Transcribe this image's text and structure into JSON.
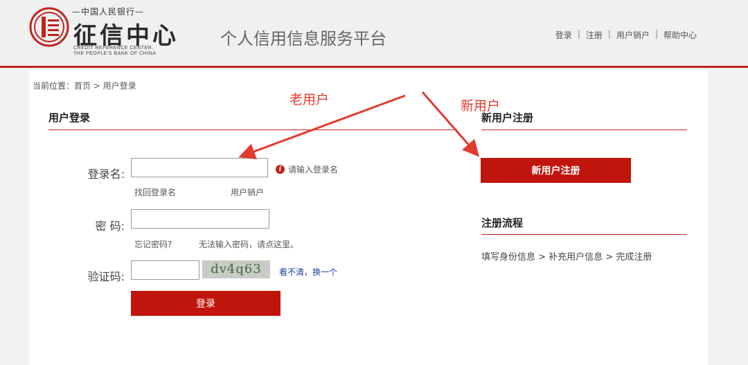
{
  "header": {
    "logo_small": "—中国人民银行—",
    "logo_main": "征信中心",
    "logo_en_line1": "CREDIT REFERENCE CENTER,",
    "logo_en_line2": "THE PEOPLE'S BANK OF CHINA",
    "platform_title": "个人信用信息服务平台",
    "nav": [
      {
        "label": "登录"
      },
      {
        "label": "注册"
      },
      {
        "label": "用户销户"
      },
      {
        "label": "帮助中心"
      }
    ],
    "nav_separator": "|"
  },
  "breadcrumb": "当前位置：首页 > 用户登录",
  "login": {
    "section_title": "用户登录",
    "username_label": "登录名:",
    "username_value": "",
    "username_hint": "请输入登录名",
    "forgot_username": "找回登录名",
    "cancel_account": "用户销户",
    "password_label": "密  码:",
    "password_value": "",
    "forgot_password": "忘记密码?",
    "cannot_input_password": "无法输入密码，请点这里。",
    "captcha_label": "验证码:",
    "captcha_value": "",
    "captcha_text": "dv4q63",
    "refresh_captcha": "看不清，换一个",
    "login_button": "登录"
  },
  "register": {
    "section_title": "新用户注册",
    "register_button": "新用户注册",
    "process_title": "注册流程",
    "process_steps": "填写身份信息 > 补充用户信息 > 完成注册"
  },
  "annotations": {
    "old_user": "老用户",
    "new_user": "新用户"
  },
  "colors": {
    "brand_red": "#c0150c",
    "annotation_red": "#e23b30",
    "link_blue": "#1a3fa8"
  }
}
